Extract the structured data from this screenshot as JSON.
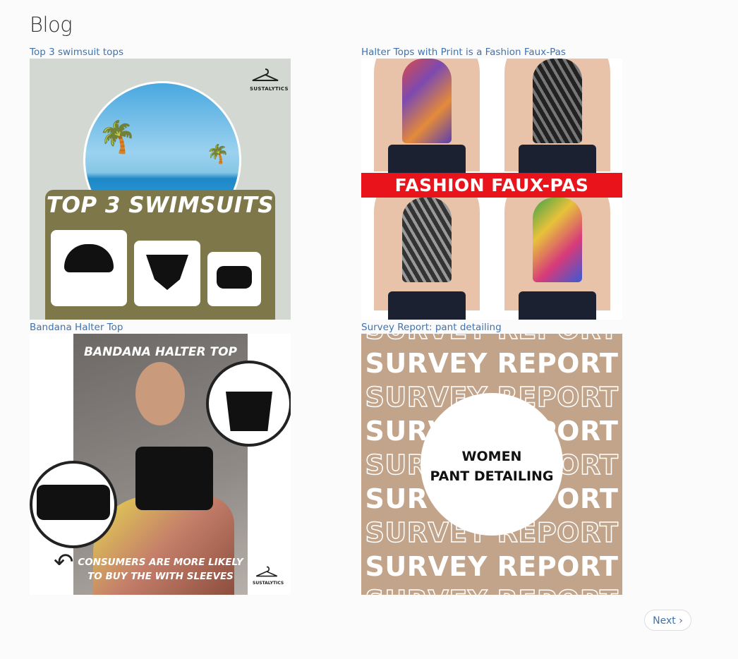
{
  "page": {
    "title": "Blog"
  },
  "posts": [
    {
      "link": "Top 3 swimsuit tops",
      "image": {
        "brand": "SUSTALYTICS",
        "headline": "TOP 3 SWIMSUITS"
      }
    },
    {
      "link": "Halter Tops with Print is a Fashion Faux-Pas",
      "image": {
        "headline": "FASHION FAUX-PAS"
      }
    },
    {
      "link": "Bandana Halter Top",
      "image": {
        "headline": "BANDANA HALTER TOP",
        "caption_line1": "CONSUMERS ARE MORE LIKELY",
        "caption_line2": "TO BUY THE WITH SLEEVES",
        "brand": "SUSTALYTICS"
      }
    },
    {
      "link": "Survey Report: pant detailing",
      "image": {
        "repeat_text": "SURVEY REPORT",
        "circle_line1": "WOMEN",
        "circle_line2": "PANT DETAILING"
      }
    }
  ],
  "pagination": {
    "next_label": "Next ›"
  },
  "colors": {
    "link": "#3f73b0",
    "faux_pas_red": "#e8131b",
    "swimsuit_olive": "#7d774a",
    "survey_tan": "#c2a48a"
  }
}
